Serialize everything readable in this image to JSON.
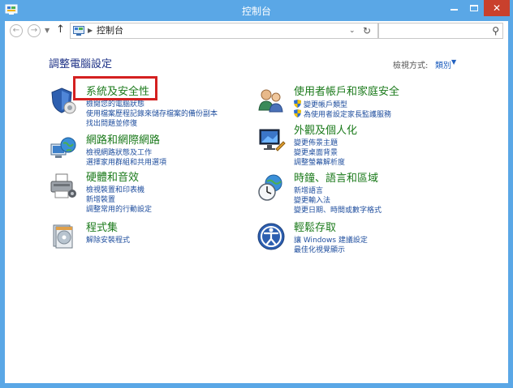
{
  "window": {
    "title": "控制台",
    "colors": {
      "frame": "#5aa7e6",
      "close": "#c9402c",
      "category": "#1b7a1b",
      "link": "#1f4e9e",
      "highlight": "#d42020"
    }
  },
  "address_bar": {
    "path": "控制台",
    "search_placeholder": ""
  },
  "page": {
    "title": "調整電腦設定",
    "view_by_label": "檢視方式:",
    "view_by_value": "類別"
  },
  "categories": [
    {
      "title": "系統及安全性",
      "icon": "security-shield-icon",
      "links": [
        "檢閱您的電腦狀態",
        "使用檔案歷程記錄來儲存檔案的備份副本",
        "找出問題並修復"
      ]
    },
    {
      "title": "網路和網際網路",
      "icon": "network-globe-icon",
      "links": [
        "檢視網路狀態及工作",
        "選擇家用群組和共用選項"
      ]
    },
    {
      "title": "硬體和音效",
      "icon": "printer-hardware-icon",
      "links": [
        "檢視裝置和印表機",
        "新增裝置",
        "調整常用的行動設定"
      ]
    },
    {
      "title": "程式集",
      "icon": "programs-icon",
      "links": [
        "解除安裝程式"
      ]
    },
    {
      "title": "使用者帳戶和家庭安全",
      "icon": "users-icon",
      "links": [
        "變更帳戶類型",
        "為使用者設定家長監護服務"
      ]
    },
    {
      "title": "外觀及個人化",
      "icon": "appearance-monitor-icon",
      "links": [
        "變更佈景主題",
        "變更桌面背景",
        "調整螢幕解析度"
      ]
    },
    {
      "title": "時鐘、語言和區域",
      "icon": "clock-globe-icon",
      "links": [
        "新增語言",
        "變更輸入法",
        "變更日期、時間或數字格式"
      ]
    },
    {
      "title": "輕鬆存取",
      "icon": "ease-of-access-icon",
      "links": [
        "讓 Windows 建議設定",
        "最佳化視覺顯示"
      ]
    }
  ]
}
